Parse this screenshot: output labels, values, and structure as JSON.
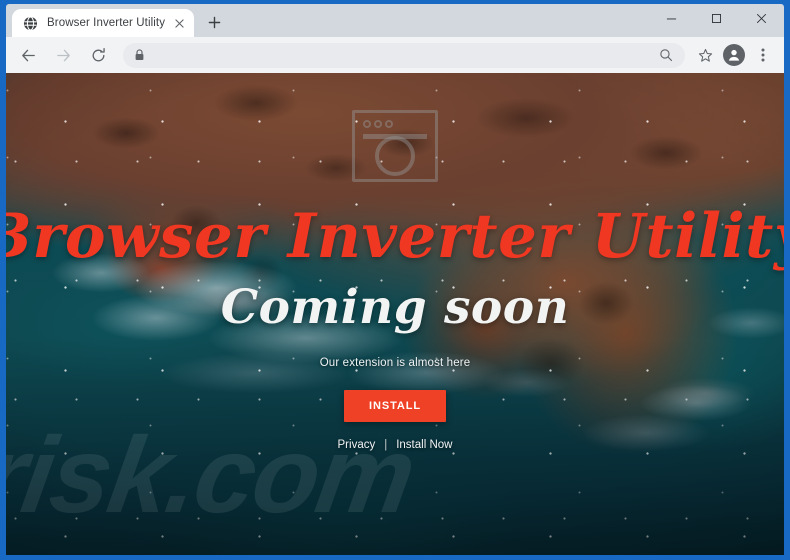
{
  "window": {
    "frame_color": "#1769c4",
    "controls": {
      "minimize_label": "Minimize",
      "maximize_label": "Maximize",
      "close_label": "Close"
    }
  },
  "tab_strip": {
    "tabs": [
      {
        "title": "Browser Inverter Utility",
        "favicon": "globe-icon",
        "close_label": "Close tab",
        "active": true
      }
    ],
    "new_tab_label": "New tab"
  },
  "toolbar": {
    "back_label": "Back",
    "forward_label": "Forward",
    "reload_label": "Reload",
    "omnibox": {
      "value": "",
      "placeholder": "",
      "lock_icon": "lock-icon",
      "search_icon": "search-icon"
    },
    "bookmark_label": "Bookmark this tab",
    "profile_label": "Profile",
    "menu_label": "Customize and control Google Chrome"
  },
  "page": {
    "logo_placeholder": "broken-image-placeholder",
    "title": "Browser Inverter Utility",
    "subtitle": "Coming soon",
    "tagline": "Our extension is almost here",
    "install_button": "INSTALL",
    "footer": {
      "privacy_label": "Privacy",
      "separator": "|",
      "install_now_label": "Install Now"
    },
    "watermark": "risk.com",
    "colors": {
      "title_red": "#f03722",
      "subtitle_white": "#f2f4f3",
      "install_button_bg": "#ef4125",
      "install_button_text": "#ffffff"
    }
  }
}
